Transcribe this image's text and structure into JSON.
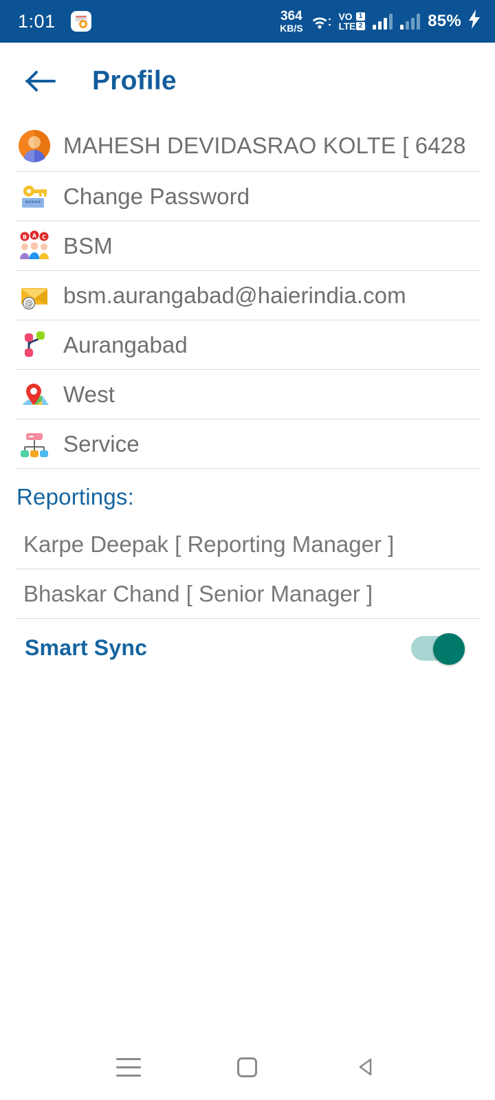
{
  "statusbar": {
    "time": "1:01",
    "app_icon": "app-notification-icon",
    "net_speed_value": "364",
    "net_speed_unit": "KB/S",
    "wifi_icon": "wifi-icon",
    "volte_line1": "VO",
    "volte_line2": "LTE",
    "volte_badge1": "1",
    "volte_badge2": "2",
    "signal1_icon": "signal-bars-icon",
    "signal2_icon": "signal-bars-icon",
    "battery": "85%",
    "charging_icon": "charging-bolt-icon",
    "bg_color": "#0b5394"
  },
  "header": {
    "back_icon": "back-arrow-icon",
    "title": "Profile",
    "title_color": "#145d9e"
  },
  "profile_rows": [
    {
      "icon": "user-avatar-icon",
      "label": "MAHESH DEVIDASRAO KOLTE [ 6428"
    },
    {
      "icon": "change-password-icon",
      "label": "Change Password"
    },
    {
      "icon": "user-group-icon",
      "label": "BSM"
    },
    {
      "icon": "email-envelope-icon",
      "label": "bsm.aurangabad@haierindia.com"
    },
    {
      "icon": "branch-hierarchy-icon",
      "label": "Aurangabad"
    },
    {
      "icon": "map-pin-icon",
      "label": "West"
    },
    {
      "icon": "org-chart-icon",
      "label": "Service"
    }
  ],
  "reportings": {
    "heading": "Reportings:",
    "items": [
      "Karpe Deepak [ Reporting Manager ]",
      "Bhaskar Chand [ Senior Manager ]"
    ]
  },
  "smart_sync": {
    "label": "Smart Sync",
    "state": "on",
    "track_color": "#a9d5d2",
    "thumb_color": "#00796b"
  },
  "navbar": {
    "recents_icon": "recents-menu-icon",
    "home_icon": "home-square-icon",
    "back_icon": "back-triangle-icon"
  }
}
